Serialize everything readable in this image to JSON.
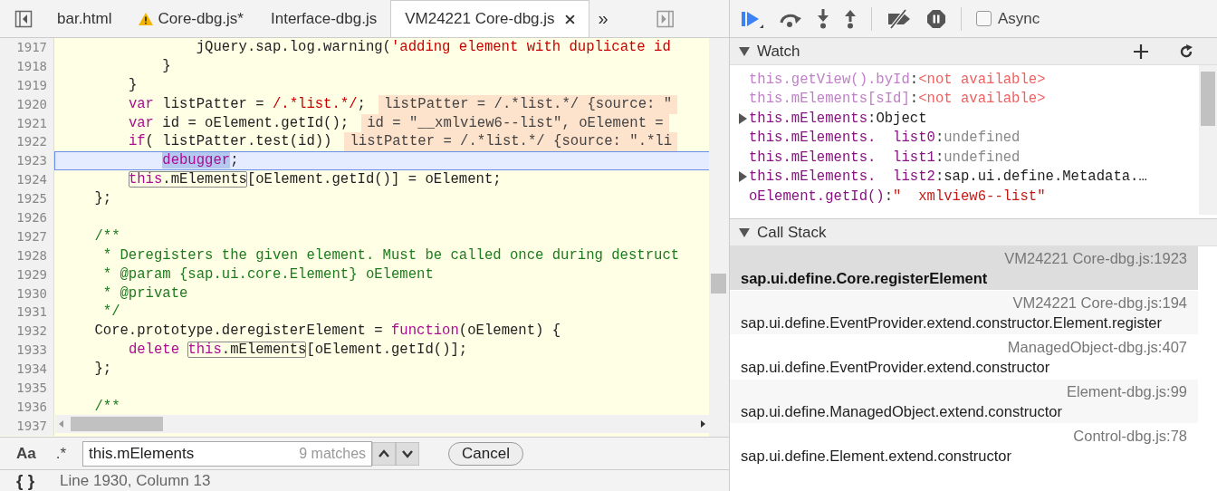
{
  "tabs": [
    {
      "label": "bar.html",
      "selected": false,
      "warning": false
    },
    {
      "label": "Core-dbg.js*",
      "selected": false,
      "warning": true
    },
    {
      "label": "Interface-dbg.js",
      "selected": false,
      "warning": false
    },
    {
      "label": "VM24221 Core-dbg.js",
      "selected": true,
      "warning": false
    }
  ],
  "more_tabs": "»",
  "code": [
    {
      "num": "1917",
      "current": false,
      "tokens": [
        {
          "kind": "plain",
          "text": "                jQuery.sap.log.warning("
        },
        {
          "kind": "str",
          "text": "'adding element with duplicate id"
        }
      ]
    },
    {
      "num": "1918",
      "current": false,
      "tokens": [
        {
          "kind": "plain",
          "text": "            }"
        }
      ]
    },
    {
      "num": "1919",
      "current": false,
      "tokens": [
        {
          "kind": "plain",
          "text": "        }"
        }
      ]
    },
    {
      "num": "1920",
      "current": false,
      "inline": "listPatter = /.*list.*/ {source: \"",
      "tokens": [
        {
          "kind": "kw",
          "text": "        var"
        },
        {
          "kind": "plain",
          "text": " listPatter = "
        },
        {
          "kind": "str",
          "text": "/.*list.*/"
        },
        {
          "kind": "plain",
          "text": ";"
        }
      ]
    },
    {
      "num": "1921",
      "current": false,
      "inline": "id = \"__xmlview6--list\", oElement =",
      "tokens": [
        {
          "kind": "kw",
          "text": "        var"
        },
        {
          "kind": "plain",
          "text": " id = oElement.getId();"
        }
      ]
    },
    {
      "num": "1922",
      "current": false,
      "inline": "listPatter = /.*list.*/ {source: \".*li",
      "tokens": [
        {
          "kind": "kw",
          "text": "        if"
        },
        {
          "kind": "plain",
          "text": "( listPatter.test(id))"
        }
      ]
    },
    {
      "num": "1923",
      "current": true,
      "tokens": [
        {
          "kind": "sel",
          "text": "            debugger"
        },
        {
          "kind": "plain",
          "text": ";"
        }
      ]
    },
    {
      "num": "1924",
      "current": false,
      "tokens": [
        {
          "kind": "match",
          "tokens": [
            {
              "kind": "kw",
              "text": "        this"
            },
            {
              "kind": "plain",
              "text": ".mElements"
            }
          ]
        },
        {
          "kind": "plain",
          "text": "[oElement.getId()] = oElement;"
        }
      ]
    },
    {
      "num": "1925",
      "current": false,
      "tokens": [
        {
          "kind": "plain",
          "text": "    };"
        }
      ]
    },
    {
      "num": "1926",
      "current": false
    },
    {
      "num": "1927",
      "current": false,
      "tokens": [
        {
          "kind": "cmt",
          "text": "    /**"
        }
      ]
    },
    {
      "num": "1928",
      "current": false,
      "tokens": [
        {
          "kind": "cmt",
          "text": "     * Deregisters the given element. Must be called once during destruct"
        }
      ]
    },
    {
      "num": "1929",
      "current": false,
      "tokens": [
        {
          "kind": "cmt",
          "text": "     * @param {sap.ui.core.Element} oElement"
        }
      ]
    },
    {
      "num": "1930",
      "current": false,
      "tokens": [
        {
          "kind": "cmt",
          "text": "     * @private"
        }
      ]
    },
    {
      "num": "1931",
      "current": false,
      "tokens": [
        {
          "kind": "cmt",
          "text": "     */"
        }
      ]
    },
    {
      "num": "1932",
      "current": false,
      "tokens": [
        {
          "kind": "plain",
          "text": "    Core.prototype.deregisterElement = "
        },
        {
          "kind": "kw",
          "text": "function"
        },
        {
          "kind": "plain",
          "text": "(oElement) {"
        }
      ]
    },
    {
      "num": "1933",
      "current": false,
      "tokens": [
        {
          "kind": "kw",
          "text": "        delete "
        },
        {
          "kind": "match",
          "tokens": [
            {
              "kind": "kw",
              "text": "this"
            },
            {
              "kind": "plain",
              "text": ".mElements"
            }
          ]
        },
        {
          "kind": "plain",
          "text": "[oElement.getId()];"
        }
      ]
    },
    {
      "num": "1934",
      "current": false,
      "tokens": [
        {
          "kind": "plain",
          "text": "    };"
        }
      ]
    },
    {
      "num": "1935",
      "current": false
    },
    {
      "num": "1936",
      "current": false,
      "tokens": [
        {
          "kind": "cmt",
          "text": "    /**"
        }
      ]
    },
    {
      "num": "1937",
      "current": false
    }
  ],
  "search": {
    "case_toggle": "Aa",
    "regex_toggle": ".*",
    "value": "this.mElements",
    "matches": "9 matches",
    "cancel": "Cancel"
  },
  "status_bar": {
    "format_button": "{ }",
    "position": "Line 1930, Column 13"
  },
  "debugger_toolbar": {
    "async_label": "Async",
    "async_checked": false
  },
  "watch": {
    "title": "Watch",
    "separator": ":",
    "items": [
      {
        "expression": "this.getView().byId",
        "value": "<not available>",
        "kind": "unavailable",
        "expandable": false
      },
      {
        "expression": "this.mElements[sId]",
        "value": "<not available>",
        "kind": "unavailable",
        "expandable": false
      },
      {
        "expression": "this.mElements",
        "value": "Object",
        "kind": "object",
        "expandable": true
      },
      {
        "expression": "this.mElements.  list0",
        "value": "undefined",
        "kind": "undefined",
        "expandable": false
      },
      {
        "expression": "this.mElements.  list1",
        "value": "undefined",
        "kind": "undefined",
        "expandable": false
      },
      {
        "expression": "this.mElements.  list2",
        "value": "sap.ui.define.Metadata.…",
        "kind": "object",
        "expandable": true
      },
      {
        "expression": "oElement.getId()",
        "value": "\"  xmlview6--list\"",
        "kind": "string",
        "expandable": false
      }
    ]
  },
  "call_stack": {
    "title": "Call Stack",
    "frames": [
      {
        "name": "sap.ui.define.Core.registerElement",
        "location": "VM24221 Core-dbg.js:1923",
        "selected": true
      },
      {
        "name": "sap.ui.define.EventProvider.extend.constructor.Element.register",
        "location": "VM24221 Core-dbg.js:194",
        "selected": false
      },
      {
        "name": "sap.ui.define.EventProvider.extend.constructor",
        "location": "ManagedObject-dbg.js:407",
        "selected": false
      },
      {
        "name": "sap.ui.define.ManagedObject.extend.constructor",
        "location": "Element-dbg.js:99",
        "selected": false
      },
      {
        "name": "sap.ui.define.Element.extend.constructor",
        "location": "Control-dbg.js:78",
        "selected": false
      }
    ]
  }
}
